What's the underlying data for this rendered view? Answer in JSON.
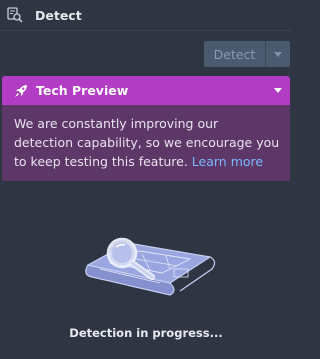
{
  "header": {
    "title": "Detect",
    "icon": "detect-icon"
  },
  "toolbar": {
    "detect_label": "Detect",
    "dropdown_icon": "chevron-down-icon"
  },
  "preview": {
    "title": "Tech Preview",
    "icon": "rocket-icon",
    "message": "We are constantly improving our detection capability, so we encourage you to keep testing this feature.",
    "link": "Learn more",
    "color": "#b33cc4"
  },
  "status": {
    "text": "Detection in progress..."
  }
}
